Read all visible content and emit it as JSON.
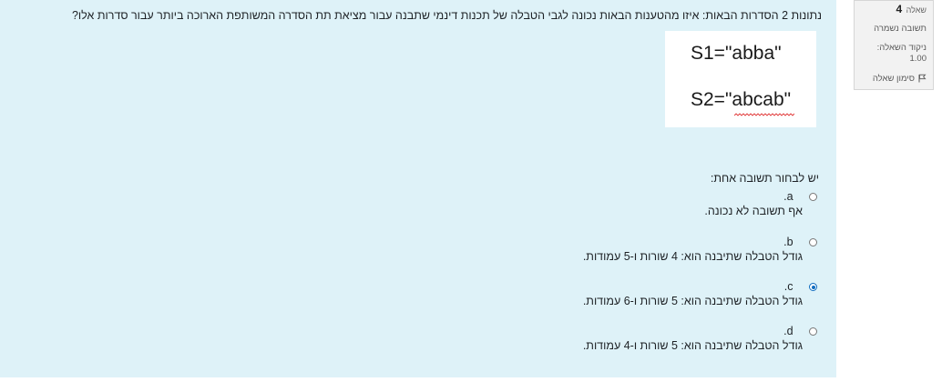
{
  "info": {
    "question_label": "שאלה",
    "question_number": "4",
    "state": "תשובה נשמרה",
    "grade_label": "ניקוד השאלה:",
    "grade_value": "1.00",
    "flag_label": "סימון שאלה"
  },
  "question": {
    "text": "נתונות 2 הסדרות הבאות: איזו מהטענות הבאות נכונה לגבי הטבלה של תכנות דינמי שתבנה עבור מציאת תת הסדרה המשותפת הארוכה ביותר עבור סדרות אלו?",
    "s1": "S1=\"abba\"",
    "s2": "S2=\"abcab\"",
    "prompt": "יש לבחור תשובה אחת:"
  },
  "answers": [
    {
      "letter": "a.",
      "text": "אף תשובה לא נכונה.",
      "checked": false
    },
    {
      "letter": "b.",
      "text": "גודל הטבלה שתיבנה הוא: 4 שורות ו-5 עמודות.",
      "checked": false
    },
    {
      "letter": "c.",
      "text": "גודל הטבלה שתיבנה הוא: 5 שורות ו-6 עמודות.",
      "checked": true
    },
    {
      "letter": "d.",
      "text": "גודל הטבלה שתיבנה הוא: 5 שורות ו-4 עמודות.",
      "checked": false
    }
  ],
  "colors": {
    "content_bg": "#def2f8",
    "info_bg": "#f2f2f2",
    "radio_selected": "#0f6cbf"
  }
}
